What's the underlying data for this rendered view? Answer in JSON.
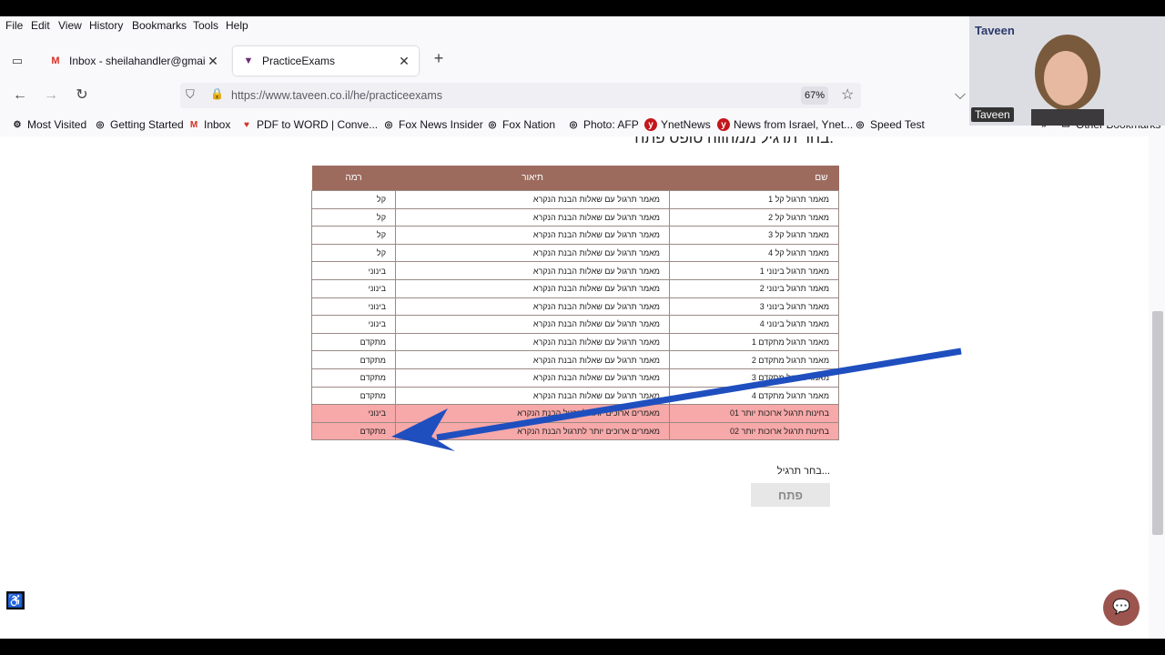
{
  "menu": [
    "File",
    "Edit",
    "View",
    "History",
    "Bookmarks",
    "Tools",
    "Help"
  ],
  "tabs": [
    {
      "title": "Inbox - sheilahandler@gmail.co",
      "icon": "gmail-icon"
    },
    {
      "title": "PracticeExams",
      "icon": "taveen-icon"
    }
  ],
  "url": "https://www.taveen.co.il/he/practiceexams",
  "zoom": "67%",
  "bookmarks": [
    {
      "label": "Most Visited",
      "icon": "gear-icon"
    },
    {
      "label": "Getting Started",
      "icon": "globe-icon"
    },
    {
      "label": "Inbox",
      "icon": "gmail-icon"
    },
    {
      "label": "PDF to WORD | Conve...",
      "icon": "heart-icon"
    },
    {
      "label": "Fox News Insider",
      "icon": "globe-icon"
    },
    {
      "label": "Fox Nation",
      "icon": "globe-icon"
    },
    {
      "label": "Photo: AFP",
      "icon": "globe-icon"
    },
    {
      "label": "YnetNews",
      "icon": "ynet-icon"
    },
    {
      "label": "News from Israel, Ynet...",
      "icon": "ynet-icon"
    },
    {
      "label": "Speed Test",
      "icon": "globe-icon"
    },
    {
      "label": "Other Bookmarks",
      "icon": "folder-icon"
    }
  ],
  "page": {
    "heading": "בחר תרגיל ממהווה טופס פתח.",
    "table": {
      "headers": [
        "שם",
        "תיאור",
        "רמה"
      ],
      "rows": [
        [
          "מאמר תרגול קל 1",
          "מאמר תרגול עם שאלות הבנת הנקרא",
          "קל"
        ],
        [
          "מאמר תרגול קל 2",
          "מאמר תרגול עם שאלות הבנת הנקרא",
          "קל"
        ],
        [
          "מאמר תרגול קל 3",
          "מאמר תרגול עם שאלות הבנת הנקרא",
          "קל"
        ],
        [
          "מאמר תרגול קל 4",
          "מאמר תרגול עם שאלות הבנת הנקרא",
          "קל"
        ],
        [
          "מאמר תרגול בינוני 1",
          "מאמר תרגול עם שאלות הבנת הנקרא",
          "בינוני"
        ],
        [
          "מאמר תרגול בינוני 2",
          "מאמר תרגול עם שאלות הבנת הנקרא",
          "בינוני"
        ],
        [
          "מאמר תרגול בינוני 3",
          "מאמר תרגול עם שאלות הבנת הנקרא",
          "בינוני"
        ],
        [
          "מאמר תרגול בינוני 4",
          "מאמר תרגול עם שאלות הבנת הנקרא",
          "בינוני"
        ],
        [
          "מאמר תרגול מתקדם 1",
          "מאמר תרגול עם שאלות הבנת הנקרא",
          "מתקדם"
        ],
        [
          "מאמר תרגול מתקדם 2",
          "מאמר תרגול עם שאלות הבנת הנקרא",
          "מתקדם"
        ],
        [
          "מאמר תרגול מתקדם 3",
          "מאמר תרגול עם שאלות הבנת הנקרא",
          "מתקדם"
        ],
        [
          "מאמר תרגול מתקדם 4",
          "מאמר תרגול עם שאלות הבנת הנקרא",
          "מתקדם"
        ],
        [
          "בחינות תרגול ארוכות יותר 01",
          "מאמרים ארוכים יותר לתרגול הבנת הנקרא",
          "בינוני"
        ],
        [
          "בחינות תרגול ארוכות יותר 02",
          "מאמרים ארוכים יותר לתרגול הבנת הנקרא",
          "מתקדם"
        ]
      ],
      "highlighted_rows": [
        12,
        13
      ]
    },
    "select_label": "בחר תרגיל...",
    "open_button": "פתח"
  },
  "webcam": {
    "name": "Taveen",
    "logo": "Taveen"
  },
  "colors": {
    "table_header": "#9c6b5e",
    "highlight": "#f7a8a8",
    "arrow": "#1f4fbf",
    "chat": "#9c544e"
  }
}
